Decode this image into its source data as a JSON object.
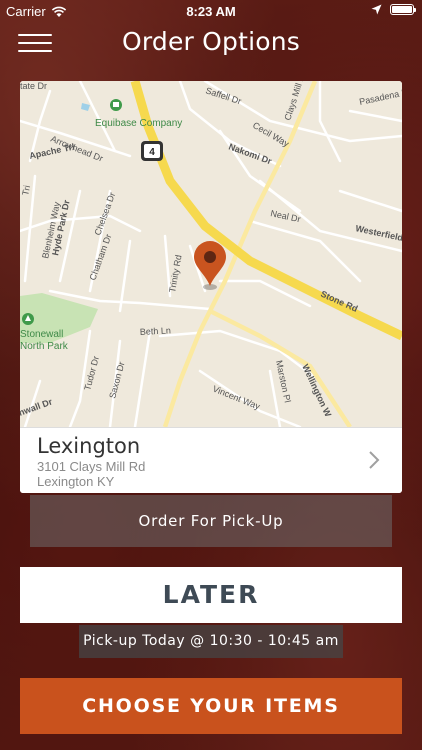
{
  "status_bar": {
    "carrier": "Carrier",
    "time": "8:23 AM"
  },
  "nav": {
    "title": "Order Options"
  },
  "map": {
    "labels": {
      "equibase": "Equibase Company",
      "route": "4",
      "arrowhead": "Arrowhead Dr",
      "apache": "Apache Trl",
      "nakomi": "Nakomi Dr",
      "cecil": "Cecil Way",
      "clays_mill": "Clays Mill Rd",
      "pasadena": "Pasadena D",
      "tate": "tate Dr",
      "saffell": "Saffell Dr",
      "hyde_park": "Hyde Park Dr",
      "blenheim": "Blenheim Way",
      "chelsea": "Chelsea Dr",
      "chatham": "Chatham Dr",
      "trinity": "Trinity Rd",
      "neal": "Neal Dr",
      "westerfield": "Westerfield",
      "stone": "Stone Rd",
      "stonewall": "Stonewall",
      "north_park": "North Park",
      "beth": "Beth Ln",
      "tudor": "Tudor Dr",
      "saxon": "Saxon Dr",
      "vincent": "Vincent Way",
      "marston": "Marston Pl",
      "wellington": "Wellington W",
      "cornwall": "nwall Dr",
      "lri": "Tri"
    }
  },
  "location": {
    "name": "Lexington",
    "street": "3101 Clays Mill Rd",
    "city": "Lexington KY"
  },
  "order_type": "Order For Pick-Up",
  "later_label": "LATER",
  "pickup_time": "Pick-up Today @ 10:30 - 10:45 am",
  "choose_label": "CHOOSE YOUR ITEMS",
  "colors": {
    "accent": "#c9521d",
    "pin": "#c9541f",
    "major_road": "#f6d94e",
    "park": "#c8e3b4"
  }
}
